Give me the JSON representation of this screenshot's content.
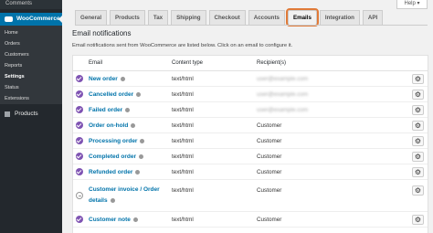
{
  "sidebar": {
    "top_label": "Comments",
    "active_label": "WooCommerce",
    "sub_items": [
      "Home",
      "Orders",
      "Customers",
      "Reports",
      "Settings",
      "Status",
      "Extensions"
    ],
    "current_sub": "Settings",
    "products_label": "Products"
  },
  "help_label": "Help ▾",
  "tabs": [
    {
      "label": "General"
    },
    {
      "label": "Products"
    },
    {
      "label": "Tax"
    },
    {
      "label": "Shipping"
    },
    {
      "label": "Checkout"
    },
    {
      "label": "Accounts"
    },
    {
      "label": "Emails"
    },
    {
      "label": "Integration"
    },
    {
      "label": "API"
    }
  ],
  "active_tab": "Emails",
  "heading": "Email notifications",
  "description": "Email notifications sent from WooCommerce are listed below. Click on an email to configure it.",
  "table": {
    "headers": {
      "email": "Email",
      "content_type": "Content type",
      "recipients": "Recipient(s)"
    },
    "rows": [
      {
        "name": "New order",
        "content_type": "text/html",
        "recipient": "user@example.com",
        "enabled": true
      },
      {
        "name": "Cancelled order",
        "content_type": "text/html",
        "recipient": "user@example.com",
        "enabled": true
      },
      {
        "name": "Failed order",
        "content_type": "text/html",
        "recipient": "user@example.com",
        "enabled": true
      },
      {
        "name": "Order on-hold",
        "content_type": "text/html",
        "recipient": "Customer",
        "enabled": true
      },
      {
        "name": "Processing order",
        "content_type": "text/html",
        "recipient": "Customer",
        "enabled": true
      },
      {
        "name": "Completed order",
        "content_type": "text/html",
        "recipient": "Customer",
        "enabled": true
      },
      {
        "name": "Refunded order",
        "content_type": "text/html",
        "recipient": "Customer",
        "enabled": true
      },
      {
        "name": "Customer invoice / Order details",
        "content_type": "text/html",
        "recipient": "Customer",
        "enabled": false
      },
      {
        "name": "Customer note",
        "content_type": "text/html",
        "recipient": "Customer",
        "enabled": true
      }
    ]
  },
  "colors": {
    "accent": "#0073aa",
    "sidebar": "#23282d",
    "enabled": "#7f54b3",
    "tab_highlight": "#e07a38"
  }
}
